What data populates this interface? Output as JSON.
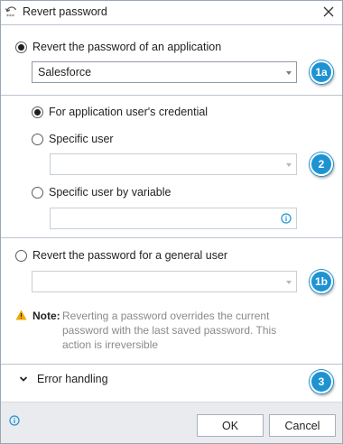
{
  "window": {
    "title": "Revert password"
  },
  "section1": {
    "radio_label": "Revert the password of an application",
    "application_select": {
      "value": "Salesforce"
    },
    "callout": "1a"
  },
  "section2": {
    "option_credential": "For application user's credential",
    "option_specific_user": "Specific user",
    "specific_user_select": {
      "value": ""
    },
    "option_variable": "Specific user by variable",
    "variable_input": {
      "value": ""
    },
    "callout": "2"
  },
  "section3": {
    "radio_label": "Revert the password for a general user",
    "general_user_select": {
      "value": ""
    },
    "callout": "1b",
    "note_label": "Note:",
    "note_text": "Reverting a password overrides the current password with the last saved password. This action is irreversible"
  },
  "section4": {
    "expander_label": "Error handling",
    "callout": "3"
  },
  "footer": {
    "ok_label": "OK",
    "cancel_label": "Cancel"
  },
  "colors": {
    "accent": "#1e93d2",
    "footer_bg": "#e9ebee",
    "warning": "#f2a900",
    "info": "#1e93d2"
  }
}
